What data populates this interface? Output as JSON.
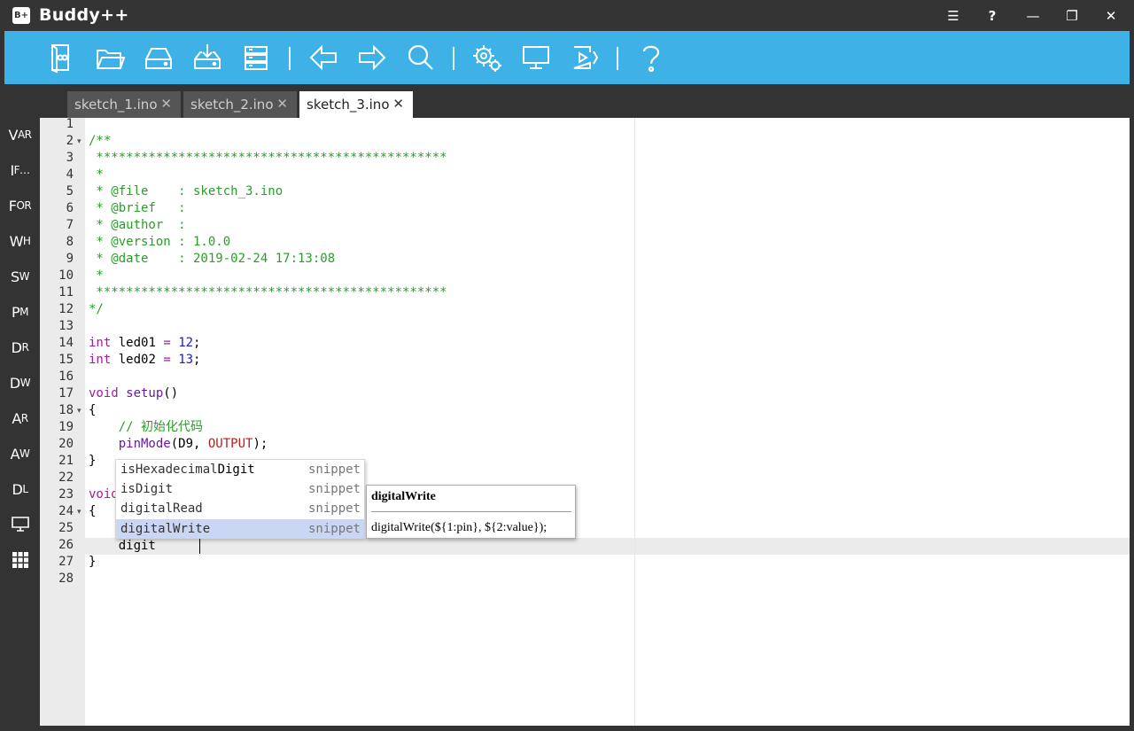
{
  "window": {
    "logo": "B+",
    "title": "Buddy++",
    "controls": {
      "menu": "☰",
      "help": "?",
      "minimize": "—",
      "restore": "❐",
      "close": "✕"
    }
  },
  "toolbar": {
    "buttons": [
      "new-sketch-icon",
      "open-folder-icon",
      "drive-icon",
      "download-icon",
      "server-icon",
      "arrow-left-icon",
      "arrow-right-icon",
      "search-icon",
      "settings-gears-icon",
      "monitor-icon",
      "upload-icon",
      "help-icon"
    ],
    "icon_color": "#ffffff",
    "background": "#3eb2e6"
  },
  "sidebar": {
    "items": [
      {
        "big": "V",
        "small": "AR"
      },
      {
        "big": "I",
        "small": "F…"
      },
      {
        "big": "F",
        "small": "OR"
      },
      {
        "big": "W",
        "small": "H"
      },
      {
        "big": "S",
        "small": "W"
      },
      {
        "big": "P",
        "small": "M"
      },
      {
        "big": "D",
        "small": "R"
      },
      {
        "big": "D",
        "small": "W"
      },
      {
        "big": "A",
        "small": "R"
      },
      {
        "big": "A",
        "small": "W"
      },
      {
        "big": "D",
        "small": "L"
      }
    ]
  },
  "tabs": [
    {
      "label": "sketch_1.ino",
      "active": false
    },
    {
      "label": "sketch_2.ino",
      "active": false
    },
    {
      "label": "sketch_3.ino",
      "active": true
    }
  ],
  "tab_close": "✕",
  "editor": {
    "line_numbers": [
      "1",
      "2",
      "3",
      "4",
      "5",
      "6",
      "7",
      "8",
      "9",
      "10",
      "11",
      "12",
      "13",
      "14",
      "15",
      "16",
      "17",
      "18",
      "19",
      "20",
      "21",
      "22",
      "23",
      "24",
      "25",
      "26",
      "27",
      "28"
    ],
    "fold_lines": [
      2,
      18,
      24
    ],
    "lines": {
      "l2": "/**",
      "l3": " ***********************************************",
      "l4": " *",
      "l5": " * @file    : sketch_3.ino",
      "l6": " * @brief   :",
      "l7": " * @author  :",
      "l8": " * @version : 1.0.0",
      "l9": " * @date    : 2019-02-24 17:13:08",
      "l10": " *",
      "l11": " ***********************************************",
      "l12": "*/",
      "l14_kw": "int",
      "l14_name": " led01 ",
      "l14_op": "=",
      "l14_num": "12",
      "l14_end": ";",
      "l15_kw": "int",
      "l15_name": " led02 ",
      "l15_op": "=",
      "l15_num": "13",
      "l15_end": ";",
      "l17_kw": "void",
      "l17_fn": " setup",
      "l17_end": "()",
      "l18": "{",
      "l19": "    // 初始化代码",
      "l20_fn": "    pinMode",
      "l20_mid": "(D9, ",
      "l20_cst": "OUTPUT",
      "l20_end": ");",
      "l21": "}",
      "l23": "void",
      "l24": "{",
      "l26": "    digit",
      "l27": "}"
    }
  },
  "autocomplete": {
    "items": [
      {
        "match": "isHexadecimal",
        "rest": "Digit",
        "meta": "snippet"
      },
      {
        "match": "isDigit",
        "rest": "",
        "meta": "snippet"
      },
      {
        "match": "digit",
        "rest": "alRead",
        "meta": "snippet"
      },
      {
        "match": "digit",
        "rest": "alWrite",
        "meta": "snippet",
        "selected": true
      }
    ]
  },
  "doc_tooltip": {
    "title": "digitalWrite",
    "signature": "digitalWrite(${1:pin}, ${2:value});"
  }
}
